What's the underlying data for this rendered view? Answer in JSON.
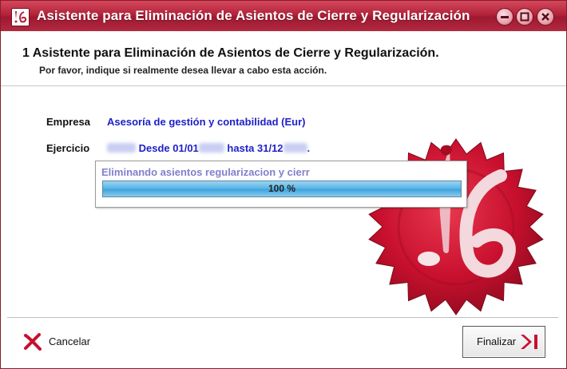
{
  "window": {
    "title": "Asistente para Eliminación de Asientos de Cierre y Regularización"
  },
  "header": {
    "step_title": "1 Asistente para Eliminación de Asientos de Cierre y Regularización.",
    "step_subtitle": "Por favor, indique si realmente desea llevar a cabo esta acción."
  },
  "form": {
    "empresa_label": "Empresa",
    "empresa_value": "Asesoría de gestión y contabilidad (Eur)",
    "ejercicio_label": "Ejercicio",
    "ejercicio_desde": "Desde 01/01",
    "ejercicio_hasta": "hasta 31/12",
    "ejercicio_end": "."
  },
  "progress": {
    "label": "Eliminando asientos regularizacion y cierr",
    "percent": 100,
    "percent_text": "100 %"
  },
  "footer": {
    "cancel_label": "Cancelar",
    "finish_label": "Finalizar"
  },
  "colors": {
    "titlebar": "#b3233a",
    "seal": "#c8102e",
    "value_text": "#2020c8",
    "progress_fill": "#4aa8de"
  },
  "icons": {
    "app": "app-logo-icon",
    "minimize": "minimize-icon",
    "maximize": "maximize-icon",
    "close": "close-icon",
    "cancel": "red-x-icon",
    "finish": "finish-arrow-icon"
  }
}
